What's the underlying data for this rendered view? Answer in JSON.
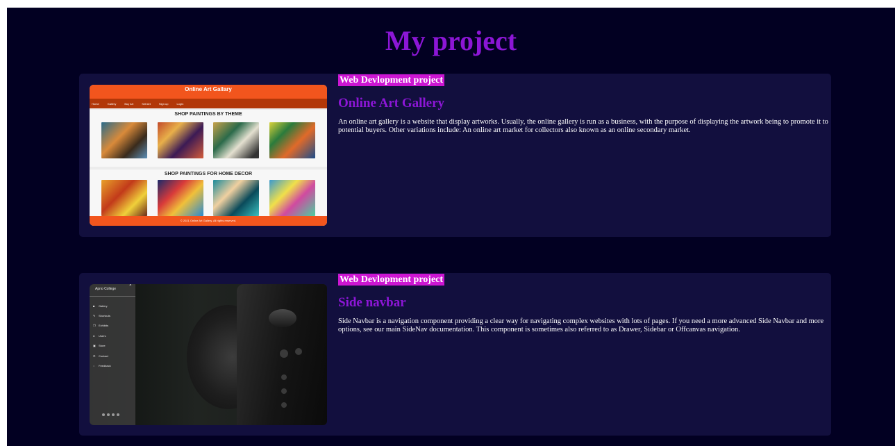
{
  "page": {
    "title": "My project"
  },
  "projects": [
    {
      "badge": "Web Devlopment project",
      "title": "Online Art Gallery",
      "description": "An online art gallery is a website that display artworks. Usually, the online gallery is run as a business, with the purpose of displaying the artwork being to promote it to potential buyers. Other variations include: An online art market for collectors also known as an online secondary market.",
      "thumbnail": {
        "site_title": "Online Art Gallary",
        "nav": [
          "Home",
          "Gallery",
          "Buy Art",
          "Sell Art",
          "Sign up",
          "Login"
        ],
        "section1": "SHOP PAINTINGS BY THEME",
        "section2": "SHOP PAINTINGS FOR HOME DECOR",
        "footer": "© 2021 Online Art Gallery. All rights reserved.",
        "accent": "#f2551d"
      }
    },
    {
      "badge": "Web Devlopment project",
      "title": "Side navbar",
      "description": "Side Navbar is a navigation component providing a clear way for navigating complex websites with lots of pages. If you need a more advanced Side Navbar and more options, see our main SideNav documentation. This component is sometimes also referred to as Drawer, Sidebar or Offcanvas navigation.",
      "thumbnail": {
        "brand": "Apno College",
        "close": "×",
        "menu": [
          {
            "icon": "gallery-icon",
            "label": "Gallery"
          },
          {
            "icon": "shortcuts-icon",
            "label": "Shortcuts"
          },
          {
            "icon": "exhibits-icon",
            "label": "Exhibits"
          },
          {
            "icon": "users-icon",
            "label": "Users"
          },
          {
            "icon": "store-icon",
            "label": "Store"
          },
          {
            "icon": "contact-icon",
            "label": "Contact"
          },
          {
            "icon": "feedback-icon",
            "label": "Feedback"
          }
        ]
      }
    }
  ],
  "colors": {
    "background": "#020022",
    "card": "#120f3e",
    "title": "#8c16d6",
    "badge": "#cc16d2"
  }
}
